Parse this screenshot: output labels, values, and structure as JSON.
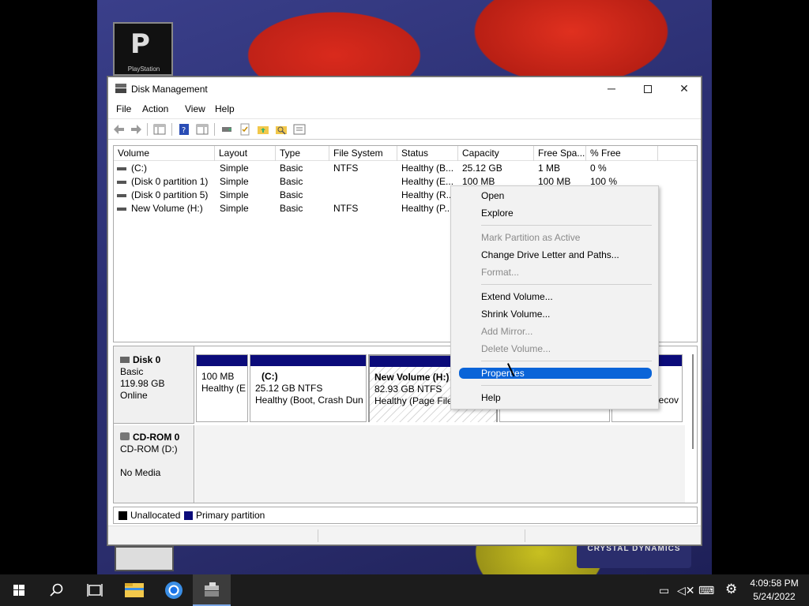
{
  "window": {
    "title": "Disk Management",
    "min_glyph": "─",
    "close_glyph": "✕"
  },
  "menubar": [
    "File",
    "Action",
    "View",
    "Help"
  ],
  "volume_table": {
    "columns": [
      "Volume",
      "Layout",
      "Type",
      "File System",
      "Status",
      "Capacity",
      "Free Spa...",
      "% Free"
    ],
    "rows": [
      [
        "(C:)",
        "Simple",
        "Basic",
        "NTFS",
        "Healthy (B...",
        "25.12 GB",
        "1 MB",
        "0 %"
      ],
      [
        "(Disk 0 partition 1)",
        "Simple",
        "Basic",
        "",
        "Healthy (E...",
        "100 MB",
        "100 MB",
        "100 %"
      ],
      [
        "(Disk 0 partition 5)",
        "Simple",
        "Basic",
        "",
        "Healthy (R...",
        "",
        "",
        ""
      ],
      [
        "New Volume (H:)",
        "Simple",
        "Basic",
        "NTFS",
        "Healthy (P...",
        "",
        "",
        ""
      ]
    ]
  },
  "disk0": {
    "name": "Disk 0",
    "type": "Basic",
    "size": "119.98 GB",
    "status": "Online",
    "partitions": [
      {
        "line1": "",
        "line2": "100 MB",
        "line3": "Healthy (E"
      },
      {
        "line1": "(C:)",
        "line2": "25.12 GB NTFS",
        "line3": "Healthy (Boot, Crash Dun"
      },
      {
        "line1": "New Volume  (H:)",
        "line2": "82.93 GB NTFS",
        "line3": "Healthy (Page File,"
      },
      {
        "line1": "",
        "line2": "",
        "line3": ""
      },
      {
        "line1": "",
        "line2": "",
        "line3": "ecov"
      }
    ]
  },
  "cdrom0": {
    "name": "CD-ROM 0",
    "drive": "CD-ROM (D:)",
    "media": "No Media"
  },
  "legend": {
    "unallocated": "Unallocated",
    "primary": "Primary partition",
    "unallocated_color": "#000000",
    "primary_color": "#0b0b7a"
  },
  "context_menu": {
    "open": "Open",
    "explore": "Explore",
    "mark_active": "Mark Partition as Active",
    "change_letter": "Change Drive Letter and Paths...",
    "format": "Format...",
    "extend": "Extend Volume...",
    "shrink": "Shrink Volume...",
    "add_mirror": "Add Mirror...",
    "delete": "Delete Volume...",
    "properties": "Properties",
    "help": "Help"
  },
  "wallpaper": {
    "ps_word": "PlayStation",
    "crystal_text": "CRYSTAL DYNAMICS"
  },
  "taskbar": {
    "time": "4:09:58 PM",
    "date": "5/24/2022"
  },
  "colors": {
    "accent": "#0a64d8",
    "primary_partition": "#0b0b7a",
    "taskbar": "#1c1c1c"
  }
}
